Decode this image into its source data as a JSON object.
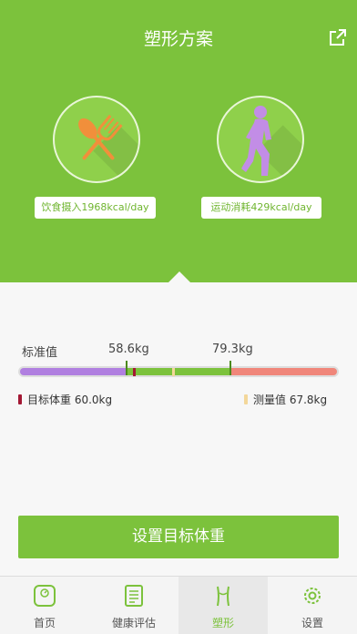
{
  "header": {
    "title": "塑形方案",
    "share_icon": "share-icon",
    "bg_color": "#7cc23c"
  },
  "diet": {
    "icon": "fork-spoon-icon",
    "label": "饮食摄入1968kcal/day"
  },
  "exercise": {
    "icon": "runner-icon",
    "label": "运动消耗429kcal/day"
  },
  "scale": {
    "standard_label": "标准值",
    "lower_bound": "58.6kg",
    "upper_bound": "79.3kg",
    "lower_value": 58.6,
    "upper_value": 79.3,
    "target_value": 60.0,
    "measured_value": 67.8,
    "colors": {
      "under": "#b07fe0",
      "normal": "#7cc23c",
      "over": "#f0867a",
      "target": "#a31834",
      "measured": "#f3d79a"
    }
  },
  "legend": {
    "target": "目标体重 60.0kg",
    "measured": "测量值 67.8kg"
  },
  "action": {
    "set_target_label": "设置目标体重"
  },
  "tabbar": {
    "tabs": [
      {
        "label": "首页",
        "icon": "scale-icon"
      },
      {
        "label": "健康评估",
        "icon": "report-icon"
      },
      {
        "label": "塑形",
        "icon": "body-shape-icon",
        "active": true
      },
      {
        "label": "设置",
        "icon": "gear-icon"
      }
    ]
  }
}
